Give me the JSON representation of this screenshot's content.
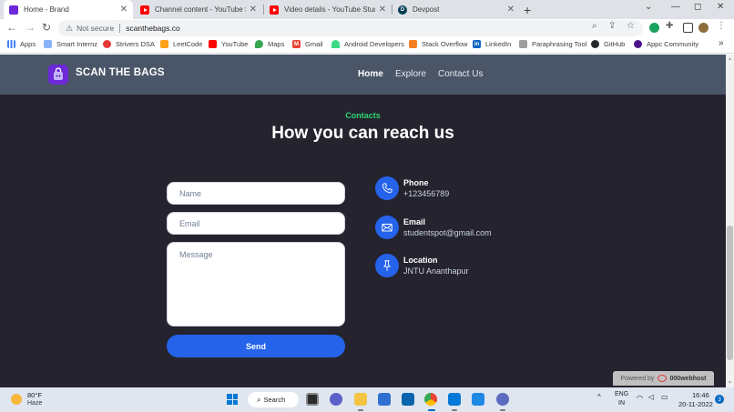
{
  "browser": {
    "tabs": [
      {
        "title": "Home - Brand",
        "active": true,
        "icon": "purple-brand-icon"
      },
      {
        "title": "Channel content - YouTube Studio",
        "active": false,
        "icon": "youtube-icon"
      },
      {
        "title": "Video details - YouTube Studio",
        "active": false,
        "icon": "youtube-icon"
      },
      {
        "title": "Devpost",
        "active": false,
        "icon": "devpost-icon"
      }
    ],
    "new_tab": "+",
    "window_controls": {
      "dropdown": "⌄",
      "minimize": "—",
      "maximize": "◻",
      "close": "✕"
    },
    "security_label": "Not secure",
    "url": "scanthebags.co",
    "bookmarks": [
      {
        "label": "Apps"
      },
      {
        "label": "Smart Internz"
      },
      {
        "label": "Strivers DSA"
      },
      {
        "label": "LeetCode"
      },
      {
        "label": "YouTube"
      },
      {
        "label": "Maps"
      },
      {
        "label": "Gmail"
      },
      {
        "label": "Android Developers"
      },
      {
        "label": "Stack Overflow"
      },
      {
        "label": "LinkedIn"
      },
      {
        "label": "Paraphrasing Tool"
      },
      {
        "label": "GitHub"
      },
      {
        "label": "Appc Community"
      }
    ],
    "bookmarks_more": "»"
  },
  "site": {
    "brand": "SCAN THE BAGS",
    "nav": [
      "Home",
      "Explore",
      "Contact Us"
    ],
    "contact_section": {
      "eyebrow": "Contacts",
      "title": "How you can reach us",
      "form": {
        "name_placeholder": "Name",
        "email_placeholder": "Email",
        "message_placeholder": "Message",
        "submit_label": "Send"
      },
      "details": [
        {
          "label": "Phone",
          "value": "+123456789",
          "icon": "phone-icon"
        },
        {
          "label": "Email",
          "value": "studentspot@gmail.com",
          "icon": "mail-icon"
        },
        {
          "label": "Location",
          "value": "JNTU Ananthapur",
          "icon": "pin-icon"
        }
      ]
    },
    "powered_by": {
      "prefix": "Powered by",
      "host": "000webhost"
    }
  },
  "taskbar": {
    "weather": {
      "temp": "80°F",
      "condition": "Haze"
    },
    "search_label": "Search",
    "language": {
      "lang": "ENG",
      "region": "IN"
    },
    "time": "16:46",
    "date": "20-11-2022",
    "notification_count": "3"
  },
  "colors": {
    "page_bg": "#24232e",
    "site_nav_bg": "#4a5568",
    "accent_blue": "#2563eb",
    "eyebrow_green": "#2ed573"
  }
}
